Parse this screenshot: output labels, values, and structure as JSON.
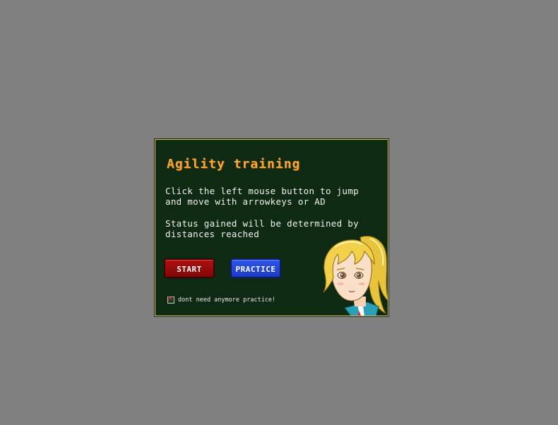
{
  "dialog": {
    "title": "Agility training",
    "instructions": [
      "Click the left mouse button to jump",
      "and move with arrowkeys or AD"
    ],
    "status_text": [
      "Status gained will be determined by",
      "distances reached"
    ],
    "start_label": "START",
    "practice_label": "PRACTICE",
    "checkbox": {
      "label": "dont need anymore practice!",
      "checked": true,
      "mark": "✕"
    }
  },
  "colors": {
    "background": "#808080",
    "dialog_bg": "#0f2a12",
    "title": "#f4a83a",
    "start_button": "#a00c0c",
    "practice_button": "#2a4fe0"
  },
  "icons": {
    "character": "blonde-girl-character-portrait"
  }
}
